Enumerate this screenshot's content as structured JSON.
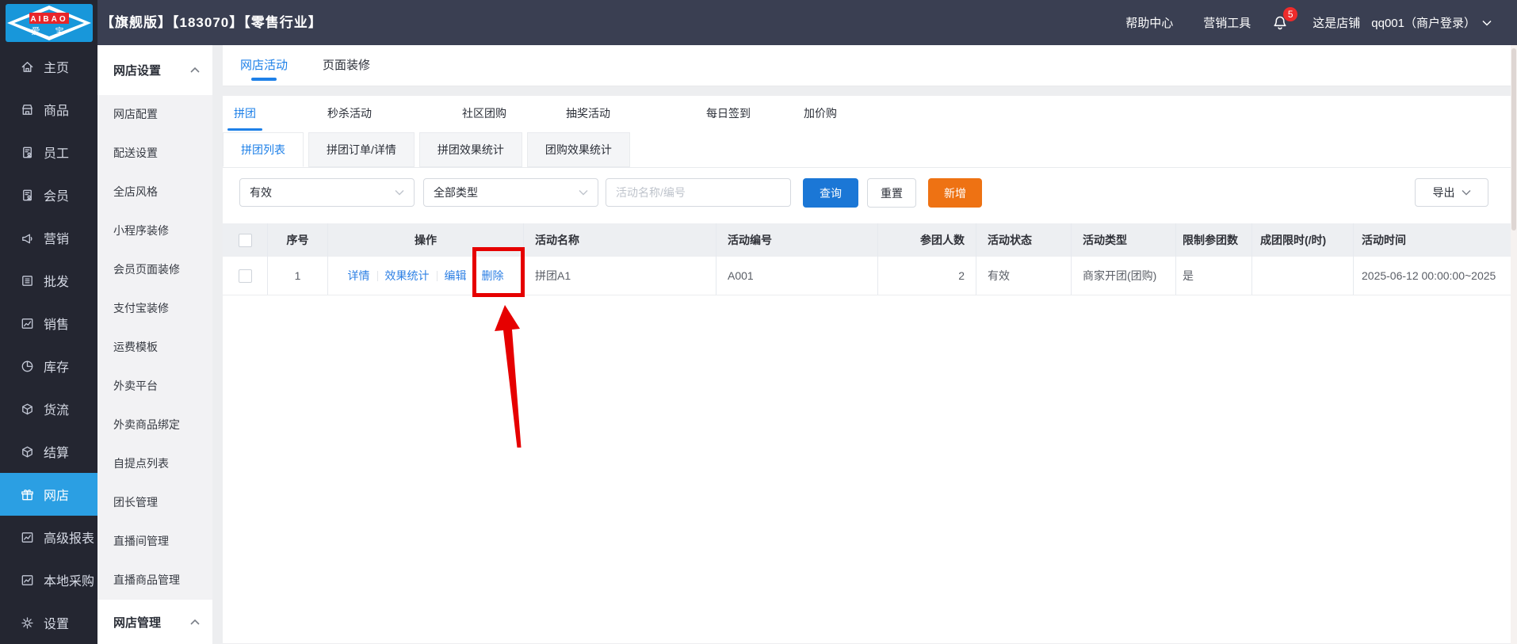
{
  "topbar": {
    "logo": {
      "line1": "AIBAO",
      "line2": "爱 宝"
    },
    "title": "【旗舰版】【183070】【零售行业】",
    "help": "帮助中心",
    "marketing_tools": "营销工具",
    "notification_count": "5",
    "shop_label": "这是店铺",
    "user": "qq001（商户登录）"
  },
  "sidebar": {
    "items": [
      {
        "label": "主页",
        "icon": "home-icon"
      },
      {
        "label": "商品",
        "icon": "store-icon"
      },
      {
        "label": "员工",
        "icon": "staff-doc-icon"
      },
      {
        "label": "会员",
        "icon": "member-doc-icon"
      },
      {
        "label": "营销",
        "icon": "megaphone-icon"
      },
      {
        "label": "批发",
        "icon": "list-icon"
      },
      {
        "label": "销售",
        "icon": "chart-icon"
      },
      {
        "label": "库存",
        "icon": "pie-icon"
      },
      {
        "label": "货流",
        "icon": "box-icon"
      },
      {
        "label": "结算",
        "icon": "box-icon"
      },
      {
        "label": "网店",
        "icon": "gift-icon"
      },
      {
        "label": "高级报表",
        "icon": "trend-icon"
      },
      {
        "label": "本地采购",
        "icon": "trend-icon"
      },
      {
        "label": "设置",
        "icon": "gear-icon"
      }
    ],
    "active": "网店"
  },
  "subsidebar": {
    "section1": "网店设置",
    "items": [
      "网店配置",
      "配送设置",
      "全店风格",
      "小程序装修",
      "会员页面装修",
      "支付宝装修",
      "运费模板",
      "外卖平台",
      "外卖商品绑定",
      "自提点列表",
      "团长管理",
      "直播间管理",
      "直播商品管理"
    ],
    "section2": "网店管理"
  },
  "main": {
    "tabs": [
      {
        "label": "网店活动"
      },
      {
        "label": "页面装修"
      }
    ],
    "activity_tabs": [
      {
        "label": "拼团"
      },
      {
        "label": "秒杀活动"
      },
      {
        "label": "社区团购"
      },
      {
        "label": "抽奖活动"
      },
      {
        "label": "每日签到"
      },
      {
        "label": "加价购"
      }
    ],
    "sub_tabs": [
      {
        "label": "拼团列表"
      },
      {
        "label": "拼团订单/详情"
      },
      {
        "label": "拼团效果统计"
      },
      {
        "label": "团购效果统计"
      }
    ],
    "filters": {
      "status_value": "有效",
      "type_value": "全部类型",
      "search_placeholder": "活动名称/编号",
      "search_value": "",
      "query_label": "查询",
      "reset_label": "重置",
      "add_label": "新增",
      "export_label": "导出"
    },
    "table": {
      "columns": [
        "",
        "序号",
        "操作",
        "活动名称",
        "活动编号",
        "参团人数",
        "活动状态",
        "活动类型",
        "限制参团数",
        "成团限时(/时)",
        "活动时间"
      ],
      "row": {
        "index": "1",
        "ops": [
          "详情",
          "效果统计",
          "编辑",
          "删除"
        ],
        "name": "拼团A1",
        "code": "A001",
        "participants": "2",
        "status": "有效",
        "type": "商家开团(团购)",
        "limit": "是",
        "group_time_limit": "",
        "time": "2025-06-12 00:00:00~2025"
      }
    }
  },
  "annotation": {
    "target": "删除",
    "shape": "red-box-and-arrow"
  },
  "colors": {
    "accent_blue": "#1e80e8",
    "query_button": "#1b77d6",
    "add_button_orange": "#ee7213",
    "sidebar_active": "#2b9fe3",
    "annotation_red": "#e60000",
    "badge_red": "#ee2b2b",
    "topbar": "#3a3f52",
    "sidebar_bg": "#242631"
  }
}
